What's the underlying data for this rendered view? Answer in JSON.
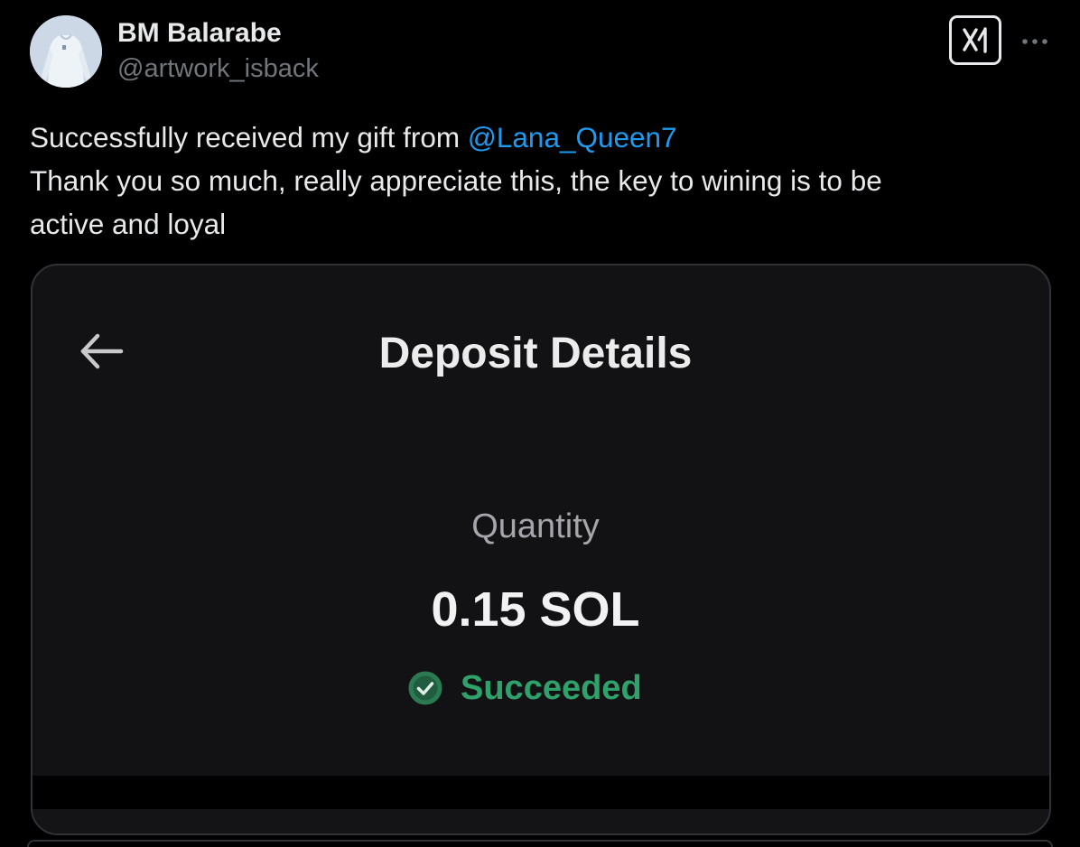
{
  "author": {
    "name": "BM Balarabe",
    "handle": "@artwork_isback",
    "avatar_icon": "avatar-image"
  },
  "actions": {
    "grok_icon": "grok-icon",
    "more_icon": "more-dots-icon"
  },
  "tweet": {
    "line1_prefix": "Successfully received my gift from ",
    "mention": "@Lana_Queen7",
    "line2": "Thank you so much, really appreciate this, the key to wining is to be",
    "line3": "active and loyal"
  },
  "media": {
    "back_icon": "back-arrow-icon",
    "title": "Deposit Details",
    "quantity_label": "Quantity",
    "quantity_value": "0.15 SOL",
    "status_icon": "check-circle-icon",
    "status": "Succeeded"
  },
  "colors": {
    "background": "#000000",
    "text_primary": "#e7e9ea",
    "text_secondary": "#71767b",
    "link": "#1d9bf0",
    "success": "#2ea26a",
    "card_border": "#2f3336"
  }
}
